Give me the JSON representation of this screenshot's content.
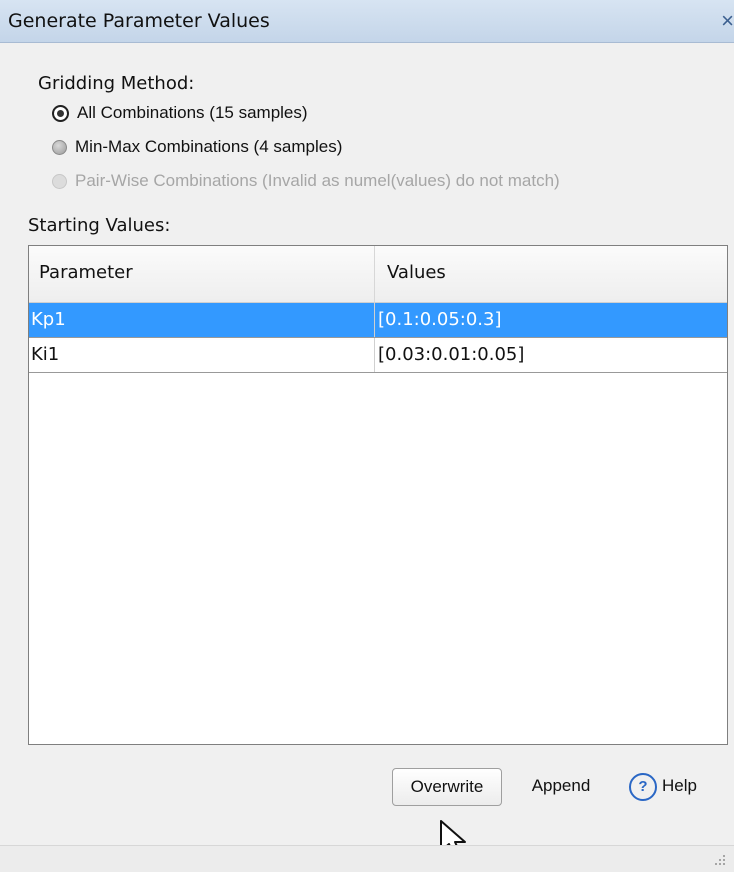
{
  "window": {
    "title": "Generate Parameter Values",
    "close_label": "×"
  },
  "gridding": {
    "label": "Gridding Method:",
    "options": [
      {
        "label": "All Combinations (15 samples)",
        "selected": true,
        "enabled": true
      },
      {
        "label": "Min-Max Combinations (4 samples)",
        "selected": false,
        "enabled": true
      },
      {
        "label": "Pair-Wise Combinations (Invalid as numel(values) do not match)",
        "selected": false,
        "enabled": false
      }
    ]
  },
  "starting_values": {
    "label": "Starting Values:",
    "columns": [
      "Parameter",
      "Values"
    ],
    "rows": [
      {
        "parameter": "Kp1",
        "values": "[0.1:0.05:0.3]",
        "selected": true
      },
      {
        "parameter": "Ki1",
        "values": "[0.03:0.01:0.05]",
        "selected": false
      }
    ]
  },
  "buttons": {
    "overwrite": "Overwrite",
    "append": "Append",
    "help": "Help"
  },
  "icons": {
    "close": "close-icon",
    "help": "help-icon",
    "cursor": "mouse-pointer-icon",
    "resize": "resize-grip-icon"
  },
  "colors": {
    "selected_row": "#3399ff",
    "title_bar": "#c4d5e9",
    "help_icon": "#2a67c5"
  }
}
